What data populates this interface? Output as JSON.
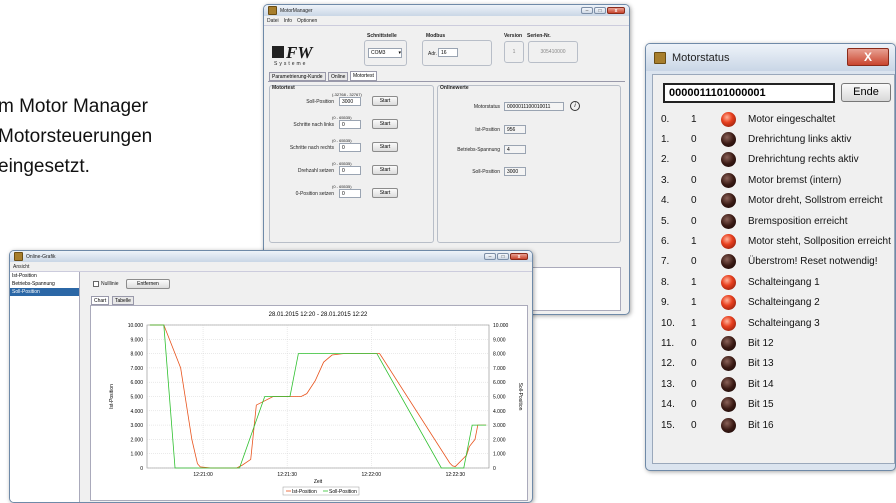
{
  "background_text": [
    "m Motor Manager",
    "Motorsteuerungen",
    "eingesetzt."
  ],
  "motor_manager": {
    "title": "MotorManager",
    "menu": [
      "Datei",
      "Info",
      "Optionen"
    ],
    "logo": "FW",
    "logo_sub": "Systeme",
    "schnittstelle_label": "Schnittstelle",
    "port": "COM3",
    "modbus_label": "Modbus",
    "adr_label": "Adr.",
    "adr_value": "16",
    "version_label": "Version",
    "version_value": "1",
    "serien_label": "Serien-Nr.",
    "serien_value": "305410000",
    "tabs": [
      "Parametrierung-Kunde",
      "Online",
      "Motortest"
    ],
    "motortest_title": "Motortest",
    "onlinewerte_title": "Onlinewerte",
    "fields": [
      {
        "range": "(-32768 - 32767)",
        "label": "Soll-Position",
        "value": "3000",
        "button": "Start"
      },
      {
        "range": "(0 - 65535)",
        "label": "Schritte nach links",
        "value": "0",
        "button": "Start"
      },
      {
        "range": "(0 - 65535)",
        "label": "Schritte nach rechts",
        "value": "0",
        "button": "Start"
      },
      {
        "range": "(0 - 65535)",
        "label": "Drehzahl setzen",
        "value": "0",
        "button": "Start"
      },
      {
        "range": "(0 - 65535)",
        "label": "0-Position setzen",
        "value": "0",
        "button": "Start"
      }
    ],
    "online": [
      {
        "label": "Motorstatus",
        "value": "0000011100010011"
      },
      {
        "label": "Ist-Position",
        "value": "956"
      },
      {
        "label": "Betriebs-Spannung",
        "value": "4"
      },
      {
        "label": "Soll-Position",
        "value": "3000"
      }
    ]
  },
  "motorstatus": {
    "title": "Motorstatus",
    "code": "0000011101000001",
    "end_button": "Ende",
    "rows": [
      {
        "n": "0.",
        "v": "1",
        "on": true,
        "label": "Motor eingeschaltet"
      },
      {
        "n": "1.",
        "v": "0",
        "on": false,
        "label": "Drehrichtung links aktiv"
      },
      {
        "n": "2.",
        "v": "0",
        "on": false,
        "label": "Drehrichtung rechts aktiv"
      },
      {
        "n": "3.",
        "v": "0",
        "on": false,
        "label": "Motor bremst (intern)"
      },
      {
        "n": "4.",
        "v": "0",
        "on": false,
        "label": "Motor dreht, Sollstrom erreicht"
      },
      {
        "n": "5.",
        "v": "0",
        "on": false,
        "label": "Bremsposition erreicht"
      },
      {
        "n": "6.",
        "v": "1",
        "on": true,
        "label": "Motor steht, Sollposition erreicht"
      },
      {
        "n": "7.",
        "v": "0",
        "on": false,
        "label": "Überstrom! Reset notwendig!"
      },
      {
        "n": "8.",
        "v": "1",
        "on": true,
        "label": "Schalteingang 1"
      },
      {
        "n": "9.",
        "v": "1",
        "on": true,
        "label": "Schalteingang 2"
      },
      {
        "n": "10.",
        "v": "1",
        "on": true,
        "label": "Schalteingang 3"
      },
      {
        "n": "11.",
        "v": "0",
        "on": false,
        "label": "Bit 12"
      },
      {
        "n": "12.",
        "v": "0",
        "on": false,
        "label": "Bit 13"
      },
      {
        "n": "13.",
        "v": "0",
        "on": false,
        "label": "Bit 14"
      },
      {
        "n": "14.",
        "v": "0",
        "on": false,
        "label": "Bit 15"
      },
      {
        "n": "15.",
        "v": "0",
        "on": false,
        "label": "Bit 16"
      }
    ]
  },
  "online_grafik": {
    "title": "Online-Grafik",
    "menu": [
      "Ansicht"
    ],
    "sidebar": [
      "Ist-Position",
      "Betriebs-Spannung",
      "Soll-Position"
    ],
    "sidebar_selected": 2,
    "nulllinie": "Nulllinie",
    "entfernen": "Entfernen",
    "tabs": [
      "Chart",
      "Tabelle"
    ]
  },
  "chart_data": {
    "type": "line",
    "title": "28.01.2015 12:20 - 28.01.2015 12:22",
    "xlabel": "Zeit",
    "ylabel_left": "Ist-Position",
    "ylabel_right": "Soll-Position",
    "ylim": [
      0,
      10000
    ],
    "y_ticks": [
      "0",
      "1.000",
      "2.000",
      "3.000",
      "4.000",
      "5.000",
      "6.000",
      "7.000",
      "8.000",
      "9.000",
      "10.000"
    ],
    "x_ticks": [
      "12:21:00",
      "12:21:30",
      "12:22:00",
      "12:22:30"
    ],
    "x_tick_seconds": [
      60,
      90,
      120,
      150
    ],
    "xlim_seconds": [
      40,
      162
    ],
    "series": [
      {
        "name": "Ist-Position",
        "color": "#e8541e",
        "x": [
          41,
          43,
          45,
          46,
          52,
          56,
          58,
          59,
          63,
          72,
          74,
          77,
          79,
          85,
          95,
          97,
          100,
          103,
          106,
          110,
          112,
          116,
          118,
          123,
          148,
          149,
          150,
          151,
          153,
          154,
          155,
          157,
          158,
          160,
          161
        ],
        "y": [
          10000,
          10000,
          10000,
          10000,
          7000,
          2000,
          300,
          80,
          0,
          0,
          200,
          600,
          4400,
          5000,
          5000,
          5200,
          6100,
          7400,
          7900,
          8000,
          8000,
          8000,
          8000,
          8000,
          350,
          150,
          100,
          300,
          700,
          900,
          1500,
          2000,
          3000,
          3000,
          3000
        ]
      },
      {
        "name": "Soll-Position",
        "color": "#2ec02e",
        "x": [
          41,
          44,
          45,
          46,
          50,
          55,
          57,
          59,
          62,
          73,
          82,
          84,
          87,
          88,
          89,
          91,
          94,
          95,
          96,
          98,
          103,
          106,
          112,
          118,
          122,
          145,
          147,
          149,
          153,
          156,
          157,
          161
        ],
        "y": [
          10000,
          10000,
          10000,
          10000,
          0,
          0,
          0,
          0,
          0,
          0,
          5000,
          5000,
          5000,
          5000,
          5000,
          5000,
          8000,
          8000,
          8000,
          8000,
          8000,
          8000,
          8000,
          8000,
          8000,
          0,
          0,
          0,
          0,
          3000,
          3000,
          3000
        ]
      }
    ],
    "legend": [
      "Ist-Position",
      "Soll-Position"
    ],
    "legend_position": "bottom",
    "grid": true
  }
}
